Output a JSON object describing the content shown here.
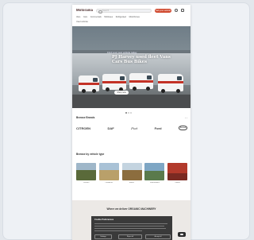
{
  "header": {
    "logo": "Motorama",
    "search_placeholder": "Search",
    "cta_label": "Sell your vehicle",
    "nav": [
      "Vans",
      "Cars",
      "Commercials",
      "Minibuses",
      "Refrigerated",
      "Motorhomes"
    ],
    "nav_row2": "Used vehicles"
  },
  "hero": {
    "eyebrow": "Find your next vehicle today",
    "title": "PJ Harvey used fleet Vans Cars Bus Bikes",
    "button": "Shop now"
  },
  "brands": {
    "title": "Browse Brands",
    "arrows": "‹ ›",
    "items": [
      "CITROEN",
      "DAF",
      "Fiat",
      "Ford",
      "Renault"
    ]
  },
  "categories": {
    "title": "Browse by vehicle type",
    "items": [
      {
        "label": "Tractors",
        "color": "#5a6a3a"
      },
      {
        "label": "Combines",
        "color": "#b9a06a"
      },
      {
        "label": "Balers",
        "color": "#8c6d3e"
      },
      {
        "label": "Telehandlers",
        "color": "#5a7a8c"
      },
      {
        "label": "Trailers",
        "color": "#b23a2c"
      }
    ]
  },
  "bottom": {
    "title": "Where we deliver ORGANIC MACHINERY"
  },
  "cookie": {
    "title": "Cookie Preferences",
    "buttons": [
      "Settings",
      "Reject all",
      "Accept all"
    ]
  }
}
